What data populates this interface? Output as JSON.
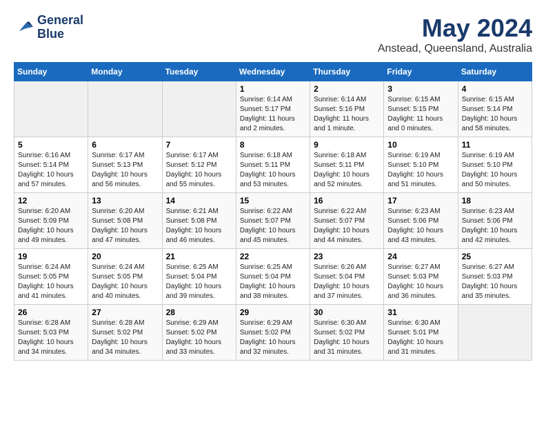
{
  "header": {
    "logo_line1": "General",
    "logo_line2": "Blue",
    "month": "May 2024",
    "location": "Anstead, Queensland, Australia"
  },
  "days_of_week": [
    "Sunday",
    "Monday",
    "Tuesday",
    "Wednesday",
    "Thursday",
    "Friday",
    "Saturday"
  ],
  "weeks": [
    [
      {
        "day": "",
        "info": ""
      },
      {
        "day": "",
        "info": ""
      },
      {
        "day": "",
        "info": ""
      },
      {
        "day": "1",
        "info": "Sunrise: 6:14 AM\nSunset: 5:17 PM\nDaylight: 11 hours\nand 2 minutes."
      },
      {
        "day": "2",
        "info": "Sunrise: 6:14 AM\nSunset: 5:16 PM\nDaylight: 11 hours\nand 1 minute."
      },
      {
        "day": "3",
        "info": "Sunrise: 6:15 AM\nSunset: 5:15 PM\nDaylight: 11 hours\nand 0 minutes."
      },
      {
        "day": "4",
        "info": "Sunrise: 6:15 AM\nSunset: 5:14 PM\nDaylight: 10 hours\nand 58 minutes."
      }
    ],
    [
      {
        "day": "5",
        "info": "Sunrise: 6:16 AM\nSunset: 5:14 PM\nDaylight: 10 hours\nand 57 minutes."
      },
      {
        "day": "6",
        "info": "Sunrise: 6:17 AM\nSunset: 5:13 PM\nDaylight: 10 hours\nand 56 minutes."
      },
      {
        "day": "7",
        "info": "Sunrise: 6:17 AM\nSunset: 5:12 PM\nDaylight: 10 hours\nand 55 minutes."
      },
      {
        "day": "8",
        "info": "Sunrise: 6:18 AM\nSunset: 5:11 PM\nDaylight: 10 hours\nand 53 minutes."
      },
      {
        "day": "9",
        "info": "Sunrise: 6:18 AM\nSunset: 5:11 PM\nDaylight: 10 hours\nand 52 minutes."
      },
      {
        "day": "10",
        "info": "Sunrise: 6:19 AM\nSunset: 5:10 PM\nDaylight: 10 hours\nand 51 minutes."
      },
      {
        "day": "11",
        "info": "Sunrise: 6:19 AM\nSunset: 5:10 PM\nDaylight: 10 hours\nand 50 minutes."
      }
    ],
    [
      {
        "day": "12",
        "info": "Sunrise: 6:20 AM\nSunset: 5:09 PM\nDaylight: 10 hours\nand 49 minutes."
      },
      {
        "day": "13",
        "info": "Sunrise: 6:20 AM\nSunset: 5:08 PM\nDaylight: 10 hours\nand 47 minutes."
      },
      {
        "day": "14",
        "info": "Sunrise: 6:21 AM\nSunset: 5:08 PM\nDaylight: 10 hours\nand 46 minutes."
      },
      {
        "day": "15",
        "info": "Sunrise: 6:22 AM\nSunset: 5:07 PM\nDaylight: 10 hours\nand 45 minutes."
      },
      {
        "day": "16",
        "info": "Sunrise: 6:22 AM\nSunset: 5:07 PM\nDaylight: 10 hours\nand 44 minutes."
      },
      {
        "day": "17",
        "info": "Sunrise: 6:23 AM\nSunset: 5:06 PM\nDaylight: 10 hours\nand 43 minutes."
      },
      {
        "day": "18",
        "info": "Sunrise: 6:23 AM\nSunset: 5:06 PM\nDaylight: 10 hours\nand 42 minutes."
      }
    ],
    [
      {
        "day": "19",
        "info": "Sunrise: 6:24 AM\nSunset: 5:05 PM\nDaylight: 10 hours\nand 41 minutes."
      },
      {
        "day": "20",
        "info": "Sunrise: 6:24 AM\nSunset: 5:05 PM\nDaylight: 10 hours\nand 40 minutes."
      },
      {
        "day": "21",
        "info": "Sunrise: 6:25 AM\nSunset: 5:04 PM\nDaylight: 10 hours\nand 39 minutes."
      },
      {
        "day": "22",
        "info": "Sunrise: 6:25 AM\nSunset: 5:04 PM\nDaylight: 10 hours\nand 38 minutes."
      },
      {
        "day": "23",
        "info": "Sunrise: 6:26 AM\nSunset: 5:04 PM\nDaylight: 10 hours\nand 37 minutes."
      },
      {
        "day": "24",
        "info": "Sunrise: 6:27 AM\nSunset: 5:03 PM\nDaylight: 10 hours\nand 36 minutes."
      },
      {
        "day": "25",
        "info": "Sunrise: 6:27 AM\nSunset: 5:03 PM\nDaylight: 10 hours\nand 35 minutes."
      }
    ],
    [
      {
        "day": "26",
        "info": "Sunrise: 6:28 AM\nSunset: 5:03 PM\nDaylight: 10 hours\nand 34 minutes."
      },
      {
        "day": "27",
        "info": "Sunrise: 6:28 AM\nSunset: 5:02 PM\nDaylight: 10 hours\nand 34 minutes."
      },
      {
        "day": "28",
        "info": "Sunrise: 6:29 AM\nSunset: 5:02 PM\nDaylight: 10 hours\nand 33 minutes."
      },
      {
        "day": "29",
        "info": "Sunrise: 6:29 AM\nSunset: 5:02 PM\nDaylight: 10 hours\nand 32 minutes."
      },
      {
        "day": "30",
        "info": "Sunrise: 6:30 AM\nSunset: 5:02 PM\nDaylight: 10 hours\nand 31 minutes."
      },
      {
        "day": "31",
        "info": "Sunrise: 6:30 AM\nSunset: 5:01 PM\nDaylight: 10 hours\nand 31 minutes."
      },
      {
        "day": "",
        "info": ""
      }
    ]
  ]
}
